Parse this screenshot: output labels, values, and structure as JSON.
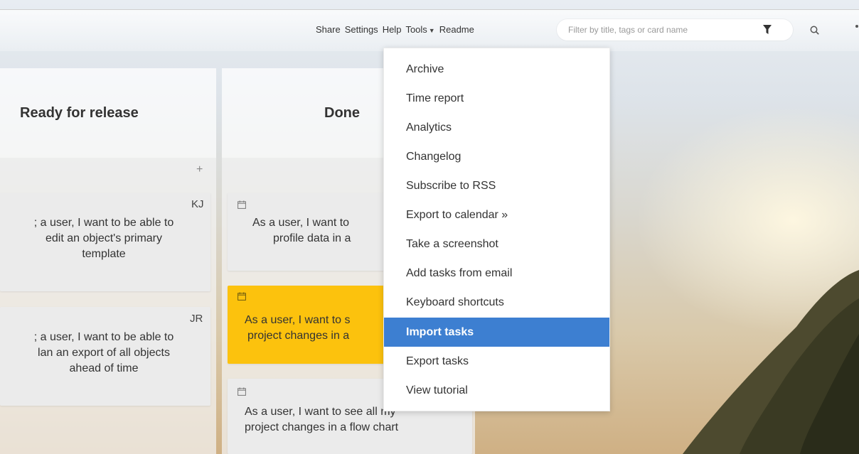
{
  "nav": {
    "share": "Share",
    "settings": "Settings",
    "help": "Help",
    "tools": "Tools",
    "readme": "Readme"
  },
  "search": {
    "placeholder": "Filter by title, tags or card name"
  },
  "columns": {
    "ready": {
      "title": "Ready for release"
    },
    "done": {
      "title": "Done"
    }
  },
  "add_card_symbol": "+",
  "cards": {
    "ready_1": {
      "initials": "KJ",
      "lines": [
        "; a user, I want to be able to",
        "edit an object's primary",
        "template"
      ]
    },
    "ready_2": {
      "initials": "JR",
      "lines": [
        "; a user, I want to be able to",
        "lan an export of all objects",
        "ahead of time"
      ]
    },
    "done_1": {
      "lines": [
        "As a user, I want to",
        "profile data in a"
      ]
    },
    "done_2": {
      "lines": [
        "As a user, I want to s",
        "project changes in a"
      ],
      "color": "#fcc20d"
    },
    "done_3": {
      "lines": [
        "As a user, I want to see all my",
        "project changes in a flow chart"
      ]
    }
  },
  "tools_menu": {
    "items": [
      "Archive",
      "Time report",
      "Analytics",
      "Changelog",
      "Subscribe to RSS",
      "Export to calendar »",
      "Take a screenshot",
      "Add tasks from email",
      "Keyboard shortcuts",
      "Import tasks",
      "Export tasks",
      "View tutorial"
    ],
    "highlighted": "Import tasks",
    "highlight_color": "#3d7fd1"
  },
  "icons": {
    "tools_caret": "caret-down-icon",
    "filter": "filter-icon",
    "search": "search-icon",
    "card_date": "calendar-icon"
  }
}
